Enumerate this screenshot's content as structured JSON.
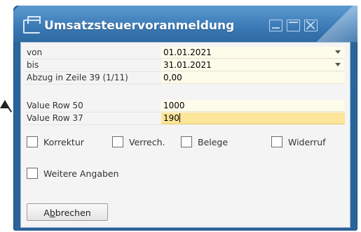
{
  "window": {
    "title": "Umsatzsteuervoranmeldung"
  },
  "fields": [
    {
      "label": "von",
      "value": "01.01.2021",
      "dropdown": true
    },
    {
      "label": "bis",
      "value": "31.01.2021",
      "dropdown": true
    },
    {
      "label": "Abzug in Zeile 39 (1/11)",
      "value": "0,00"
    },
    {
      "label": "Value Row 50",
      "value": "1000"
    },
    {
      "label": "Value Row 37",
      "value": "190",
      "focused": true
    }
  ],
  "checkboxes": [
    {
      "label": "Korrektur",
      "checked": false
    },
    {
      "label": "Verrech.",
      "checked": false
    },
    {
      "label": "Belege",
      "checked": false
    },
    {
      "label": "Widerruf",
      "checked": false
    },
    {
      "label": "Weitere Angaben",
      "checked": false
    }
  ],
  "buttons": {
    "cancel_prefix": "A",
    "cancel_mnemonic": "b",
    "cancel_suffix": "brechen"
  },
  "colors": {
    "title_bar": "#3a79b5",
    "field_bg": "#fdfbea",
    "field_focus_bg": "#fde699"
  }
}
